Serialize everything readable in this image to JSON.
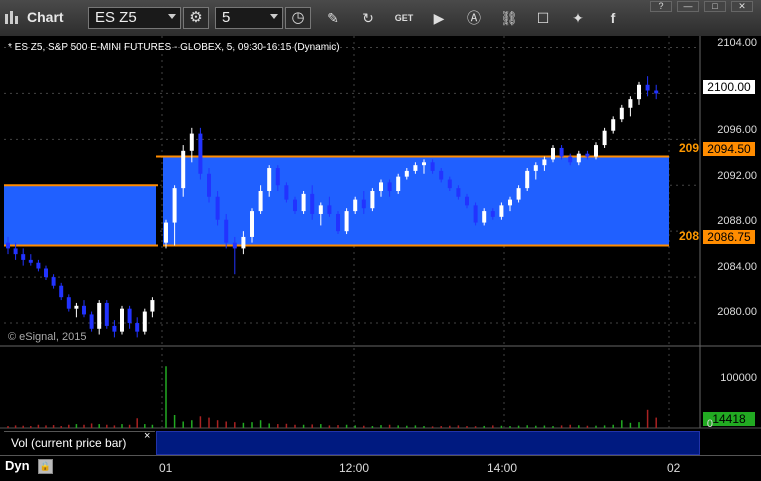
{
  "window": {
    "title": "Chart"
  },
  "toolbar": {
    "symbol": "ES Z5",
    "interval": "5",
    "icons": [
      "interval-icon",
      "clock-icon",
      "draw-icon",
      "refresh-icon",
      "get-icon",
      "play-icon",
      "alert-icon",
      "link-icon",
      "chat-icon",
      "twitter-icon",
      "facebook-icon"
    ],
    "window_buttons": [
      "?",
      "—",
      "□",
      "✕"
    ]
  },
  "chart": {
    "symbol_line": "* ES Z5, S&P 500 E-MINI FUTURES - GLOBEX, 5, 09:30-16:15 (Dynamic)",
    "copyright": "© eSignal, 2015",
    "price_labels": [
      "2104.00",
      "2096.00",
      "2092.00",
      "2088.00",
      "2084.00",
      "2080.00"
    ],
    "last_price": "2100.00",
    "upper_level": "2094.50",
    "lower_level": "2086.75",
    "upper_level_clip": "209",
    "lower_level_clip": "208",
    "vol_labels": [
      "100000",
      "0"
    ],
    "vol_last": "14418",
    "time_labels": [
      "01",
      "12:00",
      "14:00",
      "02"
    ],
    "study_label": "Vol (current price bar)",
    "study_close": "×",
    "mode": "Dyn"
  },
  "colors": {
    "up": "#ffffff",
    "down": "#2233ff",
    "band": "#2060ff",
    "level": "#ff8c00",
    "grid": "#444444",
    "vol_up": "#22aa22",
    "vol_down": "#aa2222"
  },
  "chart_data": {
    "type": "candlestick",
    "y_range": [
      2078,
      2105
    ],
    "prev_session_band": [
      2086.75,
      2092.0
    ],
    "session_band": [
      2086.75,
      2094.5
    ],
    "candles": [
      [
        2087.0,
        2087.5,
        2086.0,
        2086.5
      ],
      [
        2086.5,
        2087.0,
        2085.5,
        2086.0
      ],
      [
        2086.0,
        2086.5,
        2085.0,
        2085.5
      ],
      [
        2085.5,
        2086.0,
        2085.0,
        2085.25
      ],
      [
        2085.25,
        2085.5,
        2084.5,
        2084.75
      ],
      [
        2084.75,
        2085.0,
        2083.75,
        2084.0
      ],
      [
        2084.0,
        2084.25,
        2083.0,
        2083.25
      ],
      [
        2083.25,
        2083.5,
        2082.0,
        2082.25
      ],
      [
        2082.25,
        2082.5,
        2081.0,
        2081.25
      ],
      [
        2081.25,
        2081.75,
        2080.5,
        2081.5
      ],
      [
        2081.5,
        2082.0,
        2080.5,
        2080.75
      ],
      [
        2080.75,
        2081.0,
        2079.25,
        2079.5
      ],
      [
        2079.5,
        2082.0,
        2079.0,
        2081.75
      ],
      [
        2081.75,
        2082.0,
        2079.5,
        2079.75
      ],
      [
        2079.75,
        2080.25,
        2078.75,
        2079.25
      ],
      [
        2079.25,
        2081.5,
        2079.0,
        2081.25
      ],
      [
        2081.25,
        2081.5,
        2079.5,
        2080.0
      ],
      [
        2080.0,
        2080.5,
        2078.75,
        2079.25
      ],
      [
        2079.25,
        2081.25,
        2079.0,
        2081.0
      ],
      [
        2081.0,
        2082.25,
        2080.5,
        2082.0
      ],
      [
        2087.0,
        2089.0,
        2086.5,
        2088.75
      ],
      [
        2088.75,
        2092.0,
        2086.75,
        2091.75
      ],
      [
        2091.75,
        2095.5,
        2091.0,
        2095.0
      ],
      [
        2095.0,
        2097.0,
        2094.0,
        2096.5
      ],
      [
        2096.5,
        2097.0,
        2092.5,
        2093.0
      ],
      [
        2093.0,
        2093.5,
        2090.5,
        2091.0
      ],
      [
        2091.0,
        2091.5,
        2088.5,
        2089.0
      ],
      [
        2089.0,
        2089.5,
        2086.5,
        2087.0
      ],
      [
        2087.0,
        2087.5,
        2084.25,
        2086.5
      ],
      [
        2086.5,
        2088.0,
        2086.0,
        2087.5
      ],
      [
        2087.5,
        2090.0,
        2087.0,
        2089.75
      ],
      [
        2089.75,
        2092.0,
        2089.5,
        2091.5
      ],
      [
        2091.5,
        2093.75,
        2091.0,
        2093.5
      ],
      [
        2093.5,
        2093.75,
        2091.5,
        2092.0
      ],
      [
        2092.0,
        2092.25,
        2090.5,
        2090.75
      ],
      [
        2090.75,
        2091.0,
        2089.5,
        2089.75
      ],
      [
        2089.75,
        2091.5,
        2089.5,
        2091.25
      ],
      [
        2091.25,
        2092.0,
        2089.0,
        2089.5
      ],
      [
        2089.5,
        2090.5,
        2088.5,
        2090.25
      ],
      [
        2090.25,
        2091.0,
        2089.25,
        2089.5
      ],
      [
        2089.5,
        2089.75,
        2087.75,
        2088.0
      ],
      [
        2088.0,
        2090.0,
        2087.75,
        2089.75
      ],
      [
        2089.75,
        2091.0,
        2089.5,
        2090.75
      ],
      [
        2090.75,
        2091.5,
        2089.5,
        2090.0
      ],
      [
        2090.0,
        2091.75,
        2089.75,
        2091.5
      ],
      [
        2091.5,
        2092.5,
        2091.0,
        2092.25
      ],
      [
        2092.25,
        2092.5,
        2091.0,
        2091.5
      ],
      [
        2091.5,
        2093.0,
        2091.25,
        2092.75
      ],
      [
        2092.75,
        2093.5,
        2092.5,
        2093.25
      ],
      [
        2093.25,
        2094.0,
        2093.0,
        2093.75
      ],
      [
        2093.75,
        2094.25,
        2093.0,
        2094.0
      ],
      [
        2094.0,
        2094.25,
        2093.0,
        2093.25
      ],
      [
        2093.25,
        2093.5,
        2092.25,
        2092.5
      ],
      [
        2092.5,
        2092.75,
        2091.5,
        2091.75
      ],
      [
        2091.75,
        2092.0,
        2090.75,
        2091.0
      ],
      [
        2091.0,
        2091.25,
        2090.0,
        2090.25
      ],
      [
        2090.25,
        2090.5,
        2088.5,
        2088.75
      ],
      [
        2088.75,
        2090.0,
        2088.5,
        2089.75
      ],
      [
        2089.75,
        2090.0,
        2089.0,
        2089.25
      ],
      [
        2089.25,
        2090.5,
        2089.0,
        2090.25
      ],
      [
        2090.25,
        2091.0,
        2089.75,
        2090.75
      ],
      [
        2090.75,
        2092.0,
        2090.5,
        2091.75
      ],
      [
        2091.75,
        2093.5,
        2091.5,
        2093.25
      ],
      [
        2093.25,
        2094.0,
        2092.5,
        2093.75
      ],
      [
        2093.75,
        2094.5,
        2093.25,
        2094.25
      ],
      [
        2094.25,
        2095.5,
        2094.0,
        2095.25
      ],
      [
        2095.25,
        2095.5,
        2094.25,
        2094.5
      ],
      [
        2094.5,
        2094.75,
        2093.75,
        2094.0
      ],
      [
        2094.0,
        2095.0,
        2093.75,
        2094.75
      ],
      [
        2094.75,
        2095.0,
        2094.25,
        2094.5
      ],
      [
        2094.5,
        2095.75,
        2094.25,
        2095.5
      ],
      [
        2095.5,
        2097.0,
        2095.25,
        2096.75
      ],
      [
        2096.75,
        2098.0,
        2096.5,
        2097.75
      ],
      [
        2097.75,
        2099.0,
        2097.5,
        2098.75
      ],
      [
        2098.75,
        2099.75,
        2098.0,
        2099.5
      ],
      [
        2099.5,
        2101.0,
        2099.0,
        2100.75
      ],
      [
        2100.75,
        2101.5,
        2099.75,
        2100.25
      ],
      [
        2100.25,
        2100.75,
        2099.5,
        2100.0
      ]
    ],
    "volume": [
      3000,
      4000,
      3500,
      3000,
      5000,
      4000,
      4500,
      3000,
      5000,
      6000,
      5000,
      7000,
      6000,
      5000,
      4000,
      6000,
      5000,
      15000,
      6000,
      5000,
      95000,
      20000,
      10000,
      12000,
      18000,
      16000,
      12000,
      10000,
      9000,
      8000,
      9000,
      12000,
      7000,
      6000,
      6500,
      5000,
      5000,
      5500,
      6000,
      4000,
      4500,
      5000,
      4000,
      3500,
      3000,
      4500,
      5000,
      4000,
      3500,
      4000,
      3000,
      2500,
      3000,
      3500,
      4000,
      3000,
      2800,
      3200,
      4000,
      3500,
      3000,
      3600,
      4200,
      3500,
      3800,
      3000,
      4000,
      5000,
      4200,
      3500,
      3600,
      4000,
      5000,
      12000,
      8000,
      9000,
      28000,
      16000
    ],
    "vol_range": [
      0,
      120000
    ]
  }
}
